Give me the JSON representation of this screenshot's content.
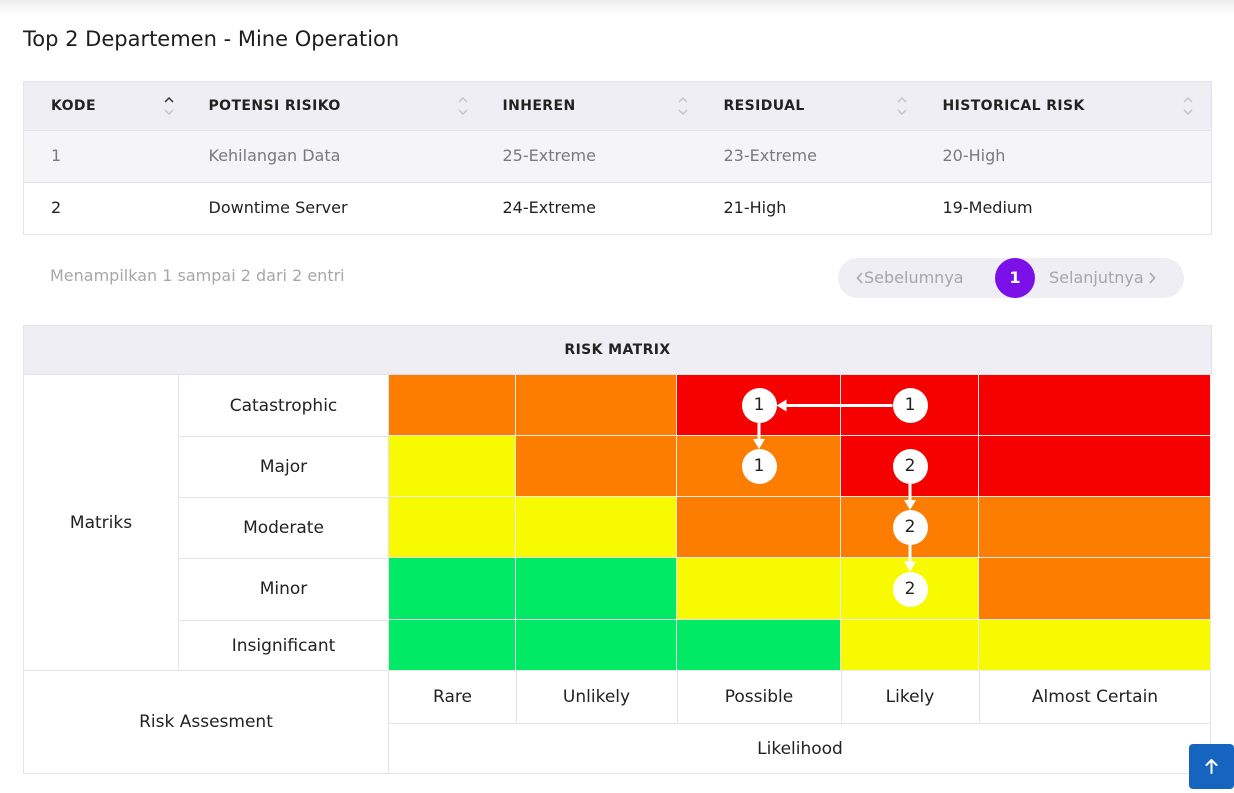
{
  "page_title": "Top 2 Departemen - Mine Operation",
  "table": {
    "columns": [
      "KODE",
      "POTENSI RISIKO",
      "INHEREN",
      "RESIDUAL",
      "HISTORICAL RISK"
    ],
    "rows": [
      [
        "1",
        "Kehilangan Data",
        "25-Extreme",
        "23-Extreme",
        "20-High"
      ],
      [
        "2",
        "Downtime Server",
        "24-Extreme",
        "21-High",
        "19-Medium"
      ]
    ]
  },
  "pagination": {
    "info": "Menampilkan 1 sampai 2 dari 2 entri",
    "prev": "Sebelumnya",
    "current": "1",
    "next": "Selanjutnya",
    "prev_icon": "chevron-left-icon",
    "next_icon": "chevron-right-icon",
    "accent": "#7b10e8"
  },
  "risk_matrix": {
    "title": "RISK MATRIX",
    "row_group_label": "Matriks",
    "impact_levels": [
      "Catastrophic",
      "Major",
      "Moderate",
      "Minor",
      "Insignificant"
    ],
    "likelihood_levels": [
      "Rare",
      "Unlikely",
      "Possible",
      "Likely",
      "Almost Certain"
    ],
    "likelihood_label": "Likelihood",
    "assessment_label": "Risk Assesment",
    "colors": {
      "green": "#00ea66",
      "yellow": "#f8fb00",
      "orange": "#fd7d00",
      "red": "#f70000"
    },
    "cell_colors": [
      [
        "orange",
        "orange",
        "red",
        "red",
        "red"
      ],
      [
        "yellow",
        "orange",
        "orange",
        "red",
        "red"
      ],
      [
        "yellow",
        "yellow",
        "orange",
        "orange",
        "orange"
      ],
      [
        "green",
        "green",
        "yellow",
        "yellow",
        "orange"
      ],
      [
        "green",
        "green",
        "green",
        "yellow",
        "yellow"
      ]
    ],
    "markers": [
      {
        "label": "1",
        "impact": "Catastrophic",
        "likelihood": "Likely"
      },
      {
        "label": "1",
        "impact": "Catastrophic",
        "likelihood": "Possible"
      },
      {
        "label": "1",
        "impact": "Major",
        "likelihood": "Possible"
      },
      {
        "label": "2",
        "impact": "Major",
        "likelihood": "Likely"
      },
      {
        "label": "2",
        "impact": "Moderate",
        "likelihood": "Likely"
      },
      {
        "label": "2",
        "impact": "Minor",
        "likelihood": "Likely"
      }
    ],
    "transitions": [
      {
        "risk": "1",
        "from": [
          "Catastrophic",
          "Likely"
        ],
        "to": [
          "Catastrophic",
          "Possible"
        ]
      },
      {
        "risk": "1",
        "from": [
          "Catastrophic",
          "Possible"
        ],
        "to": [
          "Major",
          "Possible"
        ]
      },
      {
        "risk": "2",
        "from": [
          "Major",
          "Likely"
        ],
        "to": [
          "Moderate",
          "Likely"
        ]
      },
      {
        "risk": "2",
        "from": [
          "Moderate",
          "Likely"
        ],
        "to": [
          "Minor",
          "Likely"
        ]
      }
    ]
  },
  "scroll_top": {
    "icon": "arrow-up-icon",
    "color": "#1565c0"
  }
}
